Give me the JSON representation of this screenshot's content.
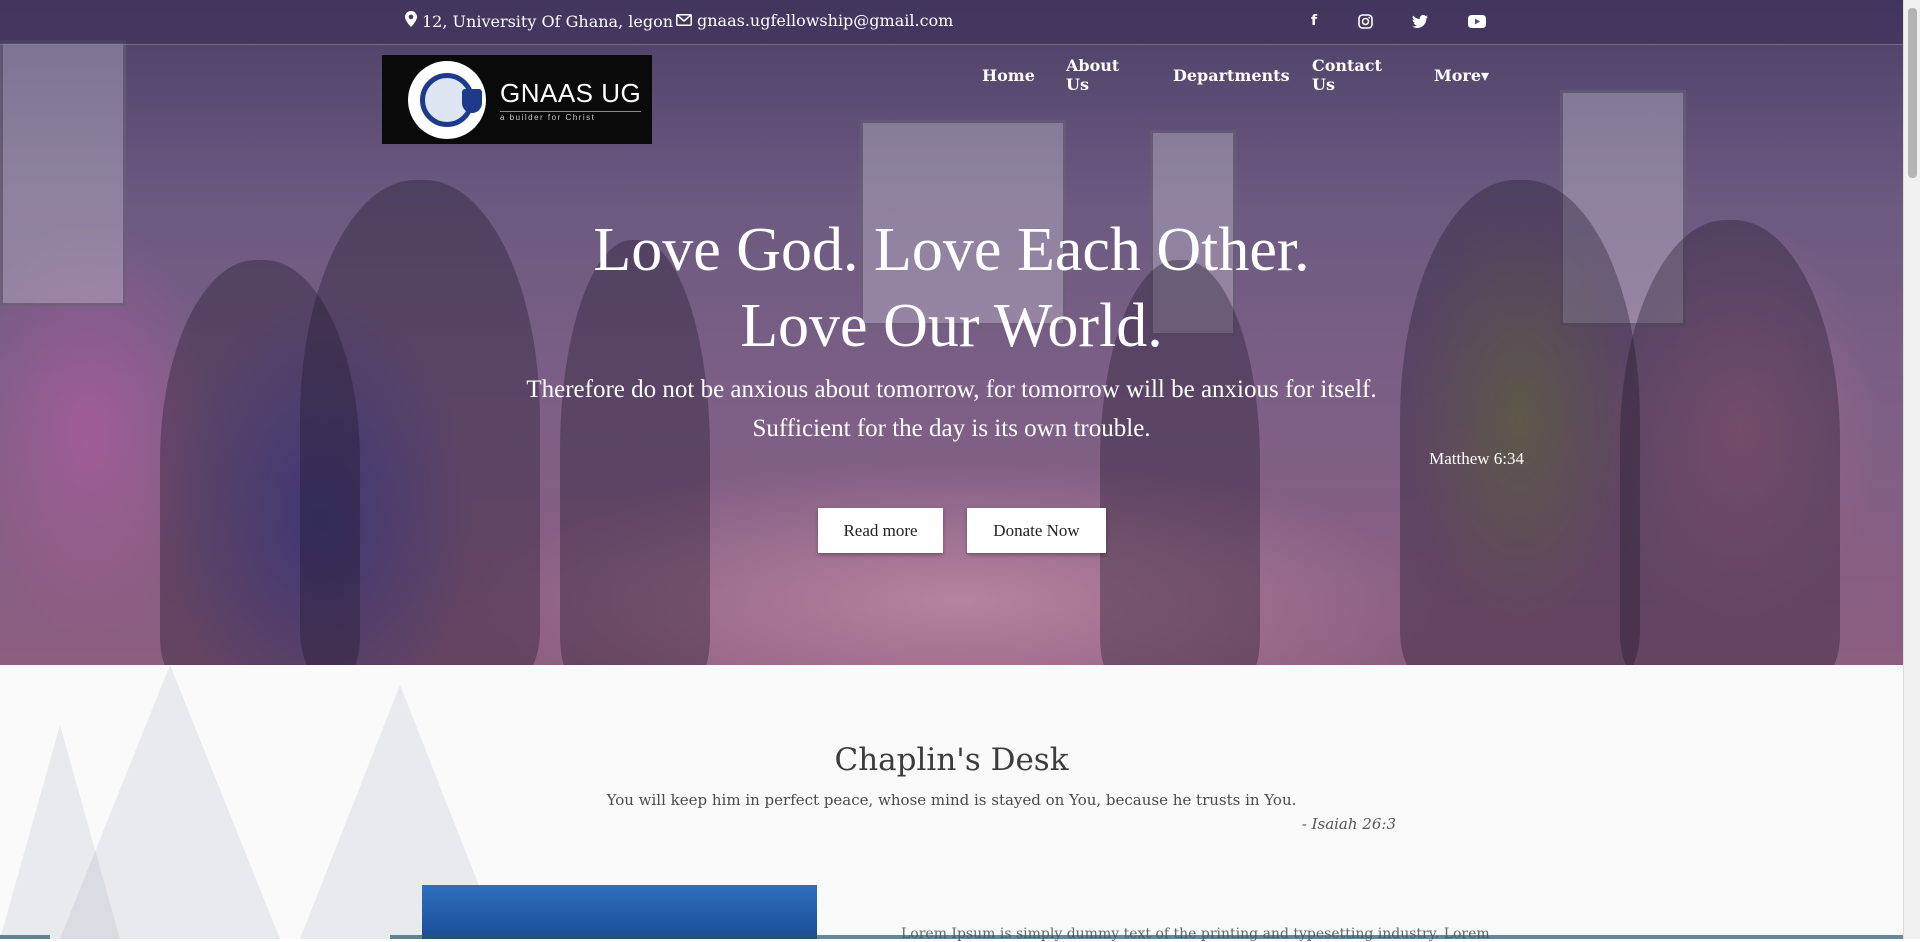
{
  "topbar": {
    "address": "12, University Of Ghana, legon",
    "email": "gnaas.ugfellowship@gmail.com",
    "social": [
      {
        "icon": "facebook-icon",
        "glyph": "f"
      },
      {
        "icon": "instagram-icon",
        "glyph": "◎"
      },
      {
        "icon": "twitter-icon",
        "glyph": "🐦"
      },
      {
        "icon": "youtube-icon",
        "glyph": "▶"
      }
    ]
  },
  "logo": {
    "name": "GNAAS UG",
    "tagline": "a builder for Christ"
  },
  "nav": {
    "items": [
      "Home",
      "About Us",
      "Departments",
      "Contact Us",
      "More"
    ],
    "more_caret": "▾"
  },
  "hero": {
    "title_line1": "Love God. Love Each Other.",
    "title_line2": "Love Our World.",
    "verse_line1": "Therefore do not be anxious about tomorrow, for tomorrow will be anxious for itself.",
    "verse_line2": "Sufficient for the day is its own trouble.",
    "verse_ref": "Matthew 6:34",
    "read_more": "Read more",
    "donate": "Donate Now"
  },
  "chaplin": {
    "title": "Chaplin's Desk",
    "quote": "You will keep him in perfect peace, whose mind is stayed on You, because he trusts in You.",
    "quote_ref": "- Isaiah 26:3",
    "lorem": "Lorem Ipsum is simply dummy text of the printing and typesetting industry. Lorem"
  },
  "colors": {
    "hero_overlay": "#5b4a78",
    "accent": "#1e3a8a"
  }
}
